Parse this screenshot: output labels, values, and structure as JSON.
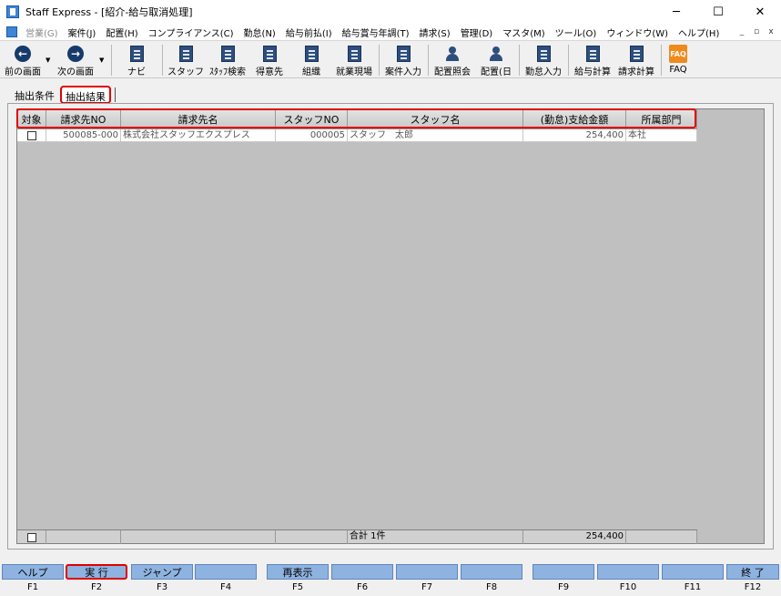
{
  "window": {
    "title": "Staff Express - [紹介-給与取消処理]",
    "controls": [
      "─",
      "☐",
      "✕"
    ]
  },
  "menu": {
    "items": [
      {
        "label": "営業(G)",
        "disabled": true
      },
      {
        "label": "案件(J)"
      },
      {
        "label": "配置(H)"
      },
      {
        "label": "コンプライアンス(C)"
      },
      {
        "label": "勤怠(N)"
      },
      {
        "label": "給与前払(I)"
      },
      {
        "label": "給与賞与年調(T)"
      },
      {
        "label": "請求(S)"
      },
      {
        "label": "管理(D)"
      },
      {
        "label": "マスタ(M)"
      },
      {
        "label": "ツール(O)"
      },
      {
        "label": "ウィンドウ(W)"
      },
      {
        "label": "ヘルプ(H)"
      }
    ],
    "mdi_controls": [
      "_",
      "▫",
      "x"
    ]
  },
  "toolbar": {
    "prev": "前の画面",
    "next": "次の画面",
    "navi": "ナビ",
    "staff": "スタッフ",
    "staff_search": "ｽﾀｯﾌ検索",
    "client": "得意先",
    "org": "組織",
    "worksite": "就業現場",
    "case_input": "案件入力",
    "placement_inquiry": "配置照会",
    "placement_day": "配置(日",
    "attendance_input": "勤怠入力",
    "payroll_calc": "給与計算",
    "billing_calc": "請求計算",
    "faq": "FAQ",
    "faq_icon_text": "FAQ"
  },
  "tabs": {
    "conditions": "抽出条件",
    "results": "抽出結果"
  },
  "grid": {
    "headers": {
      "target": "対象",
      "billing_no": "請求先NO",
      "billing_name": "請求先名",
      "staff_no": "スタッフNO",
      "staff_name": "スタッフ名",
      "amount": "(勤怠)支給金額",
      "dept": "所属部門"
    },
    "rows": [
      {
        "billing_no": "500085-000",
        "billing_name": "株式会社スタッフエクスプレス",
        "staff_no": "000005",
        "staff_name": "スタッフ　太郎",
        "amount": "254,400",
        "dept": "本社"
      }
    ],
    "footer": {
      "total_label": "合計 1件",
      "total_amount": "254,400"
    }
  },
  "fkeys": [
    {
      "label": "ヘルプ",
      "key": "F1"
    },
    {
      "label": "実 行",
      "key": "F2"
    },
    {
      "label": "ジャンプ",
      "key": "F3"
    },
    {
      "label": "",
      "key": "F4"
    },
    {
      "label": "再表示",
      "key": "F5"
    },
    {
      "label": "",
      "key": "F6"
    },
    {
      "label": "",
      "key": "F7"
    },
    {
      "label": "",
      "key": "F8"
    },
    {
      "label": "",
      "key": "F9"
    },
    {
      "label": "",
      "key": "F10"
    },
    {
      "label": "",
      "key": "F11"
    },
    {
      "label": "終 了",
      "key": "F12"
    }
  ]
}
